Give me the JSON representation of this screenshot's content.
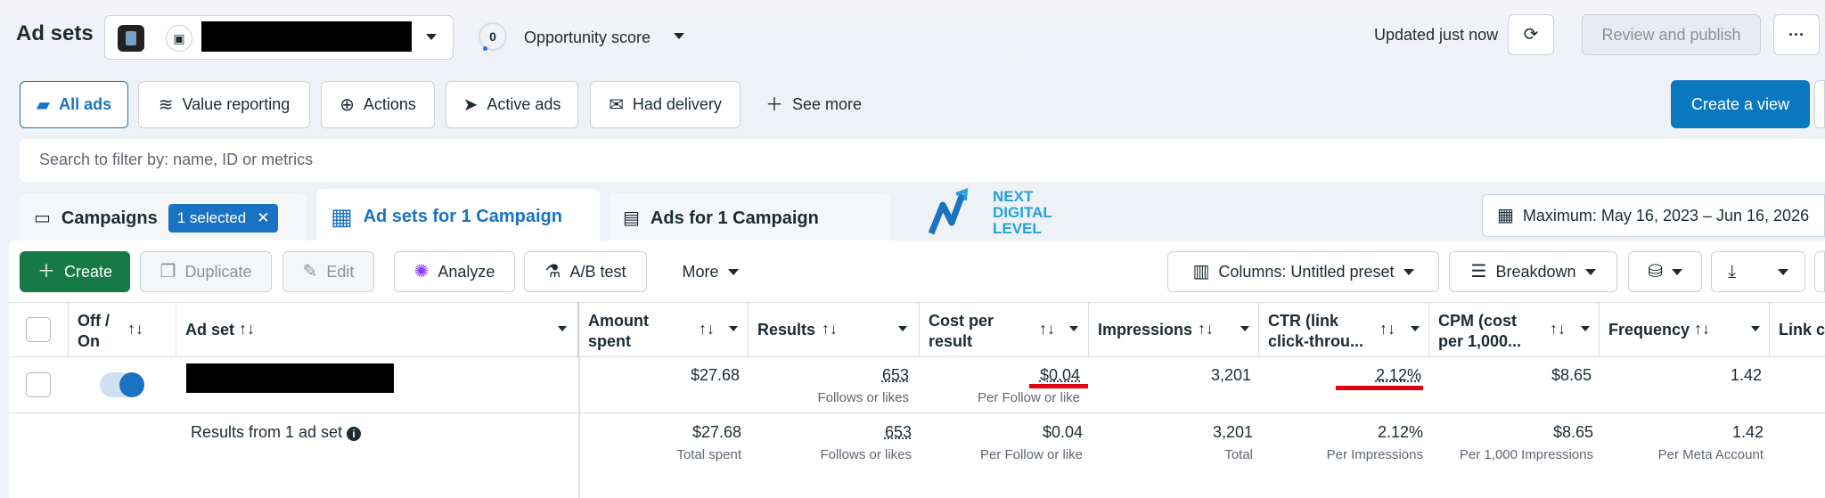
{
  "header": {
    "title": "Ad sets",
    "opportunity_score_value": "0",
    "opportunity_score_label": "Opportunity score",
    "updated": "Updated just now",
    "review_publish": "Review and publish",
    "more_dots": "···"
  },
  "views": {
    "all_ads": "All ads",
    "value_reporting": "Value reporting",
    "actions": "Actions",
    "active_ads": "Active ads",
    "had_delivery": "Had delivery",
    "see_more": "See more",
    "create_view": "Create a view"
  },
  "search": {
    "placeholder": "Search to filter by: name, ID or metrics"
  },
  "tabs": {
    "campaigns": "Campaigns",
    "selected_badge": "1 selected",
    "adsets": "Ad sets for 1 Campaign",
    "ads": "Ads for 1 Campaign"
  },
  "logo": {
    "line1": "NEXT",
    "line2": "DIGITAL",
    "line3": "LEVEL"
  },
  "date_range": "Maximum: May 16, 2023 – Jun 16, 2026",
  "toolbar": {
    "create": "Create",
    "duplicate": "Duplicate",
    "edit": "Edit",
    "analyze": "Analyze",
    "ab_test": "A/B test",
    "more": "More",
    "columns": "Columns: Untitled preset",
    "breakdown": "Breakdown"
  },
  "table": {
    "headers": {
      "offon": "Off / On",
      "adset": "Ad set",
      "amount_spent": "Amount spent",
      "results": "Results",
      "cost_per_result": "Cost per result",
      "impressions": "Impressions",
      "ctr": "CTR (link click-throu...",
      "cpm": "CPM (cost per 1,000...",
      "frequency": "Frequency",
      "link": "Link c"
    },
    "row": {
      "amount_spent": "$27.68",
      "results": "653",
      "results_sub": "Follows or likes",
      "cost": "$0.04",
      "cost_sub": "Per Follow or like",
      "impressions": "3,201",
      "ctr": "2.12%",
      "cpm": "$8.65",
      "frequency": "1.42"
    },
    "summary": {
      "label": "Results from 1 ad set",
      "amount_spent": "$27.68",
      "amount_sub": "Total spent",
      "results": "653",
      "results_sub": "Follows or likes",
      "cost": "$0.04",
      "cost_sub": "Per Follow or like",
      "impressions": "3,201",
      "impressions_sub": "Total",
      "ctr": "2.12%",
      "ctr_sub": "Per Impressions",
      "cpm": "$8.65",
      "cpm_sub": "Per 1,000 Impressions",
      "frequency": "1.42",
      "frequency_sub": "Per Meta Account"
    }
  }
}
